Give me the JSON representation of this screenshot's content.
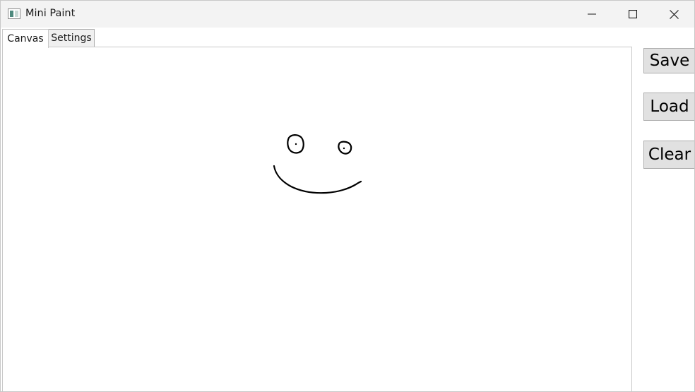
{
  "window": {
    "title": "Mini Paint",
    "icon": "app-window-icon",
    "controls": {
      "minimize": "minimize-icon",
      "maximize": "maximize-icon",
      "close": "close-icon"
    }
  },
  "tabs": [
    {
      "label": "Canvas",
      "active": true
    },
    {
      "label": "Settings",
      "active": false
    }
  ],
  "canvas": {
    "stroke_color": "#000000",
    "background": "#ffffff"
  },
  "buttons": {
    "save": "Save",
    "load": "Load",
    "clear": "Clear"
  }
}
